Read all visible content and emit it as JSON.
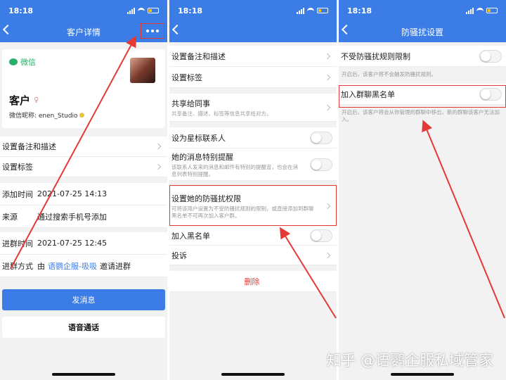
{
  "colors": {
    "accent": "#3b7ce6",
    "highlight": "#e53935",
    "wechat": "#2aae67",
    "link": "#3b7ce6",
    "delete": "#e53935"
  },
  "status_time": "18:18",
  "panel1": {
    "title": "客户详情",
    "wechat_label": "微信",
    "customer_name": "客户",
    "nickname": "微信昵称: enen_Studio",
    "rows": [
      "设置备注和描述",
      "设置标签"
    ],
    "info": [
      {
        "label": "添加时间",
        "value": "2021-07-25 14:13"
      },
      {
        "label": "来源",
        "value": "通过搜索手机号添加"
      },
      {
        "label": "进群时间",
        "value": "2021-07-25 12:45"
      }
    ],
    "join_label": "进群方式",
    "join_prefix": "由",
    "join_link": "语鹦企服-吸吸",
    "join_suffix": "邀请进群",
    "send_btn": "发消息",
    "voice_btn": "语音通话"
  },
  "panel2": {
    "rows": {
      "remark": "设置备注和描述",
      "tag": "设置标签",
      "share": "共享给同事",
      "share_sub": "共享备注、描述、标签等信息共享给对方。",
      "star": "设为星标联系人",
      "notify": "她的消息特别提醒",
      "notify_sub": "该联系人发来的消息和邮件有特别的提醒音，也会在消息列表特别提醒。",
      "harass": "设置她的防骚扰权限",
      "harass_sub": "可将该用户设置为不受防骚扰规则的限制，或直接添加到群聊黑名单不可再次加入客户群。",
      "blacklist": "加入黑名单",
      "complain": "投诉",
      "delete": "删除"
    }
  },
  "panel3": {
    "title": "防骚扰设置",
    "opt1": "不受防骚扰规则限制",
    "opt1_sub": "开启后，该客户将不会触发防骚扰规则。",
    "opt2": "加入群聊黑名单",
    "opt2_sub": "开启后，该客户将会从你管理的群聊中移出，新的群聊该客户无法加入。"
  },
  "watermark": "知乎 @语鹦企服私域管家"
}
